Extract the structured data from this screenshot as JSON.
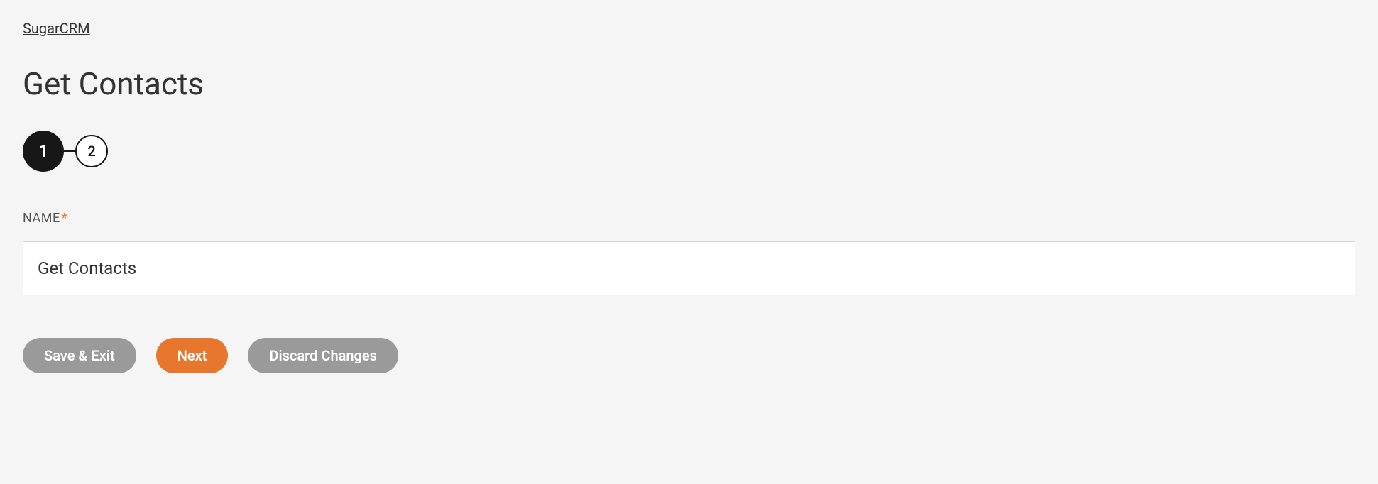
{
  "breadcrumb": {
    "label": "SugarCRM"
  },
  "page": {
    "title": "Get Contacts"
  },
  "stepper": {
    "steps": [
      {
        "label": "1",
        "active": true
      },
      {
        "label": "2",
        "active": false
      }
    ]
  },
  "form": {
    "name": {
      "label": "NAME",
      "required_marker": "*",
      "value": "Get Contacts"
    }
  },
  "buttons": {
    "save_exit": "Save & Exit",
    "next": "Next",
    "discard": "Discard Changes"
  }
}
